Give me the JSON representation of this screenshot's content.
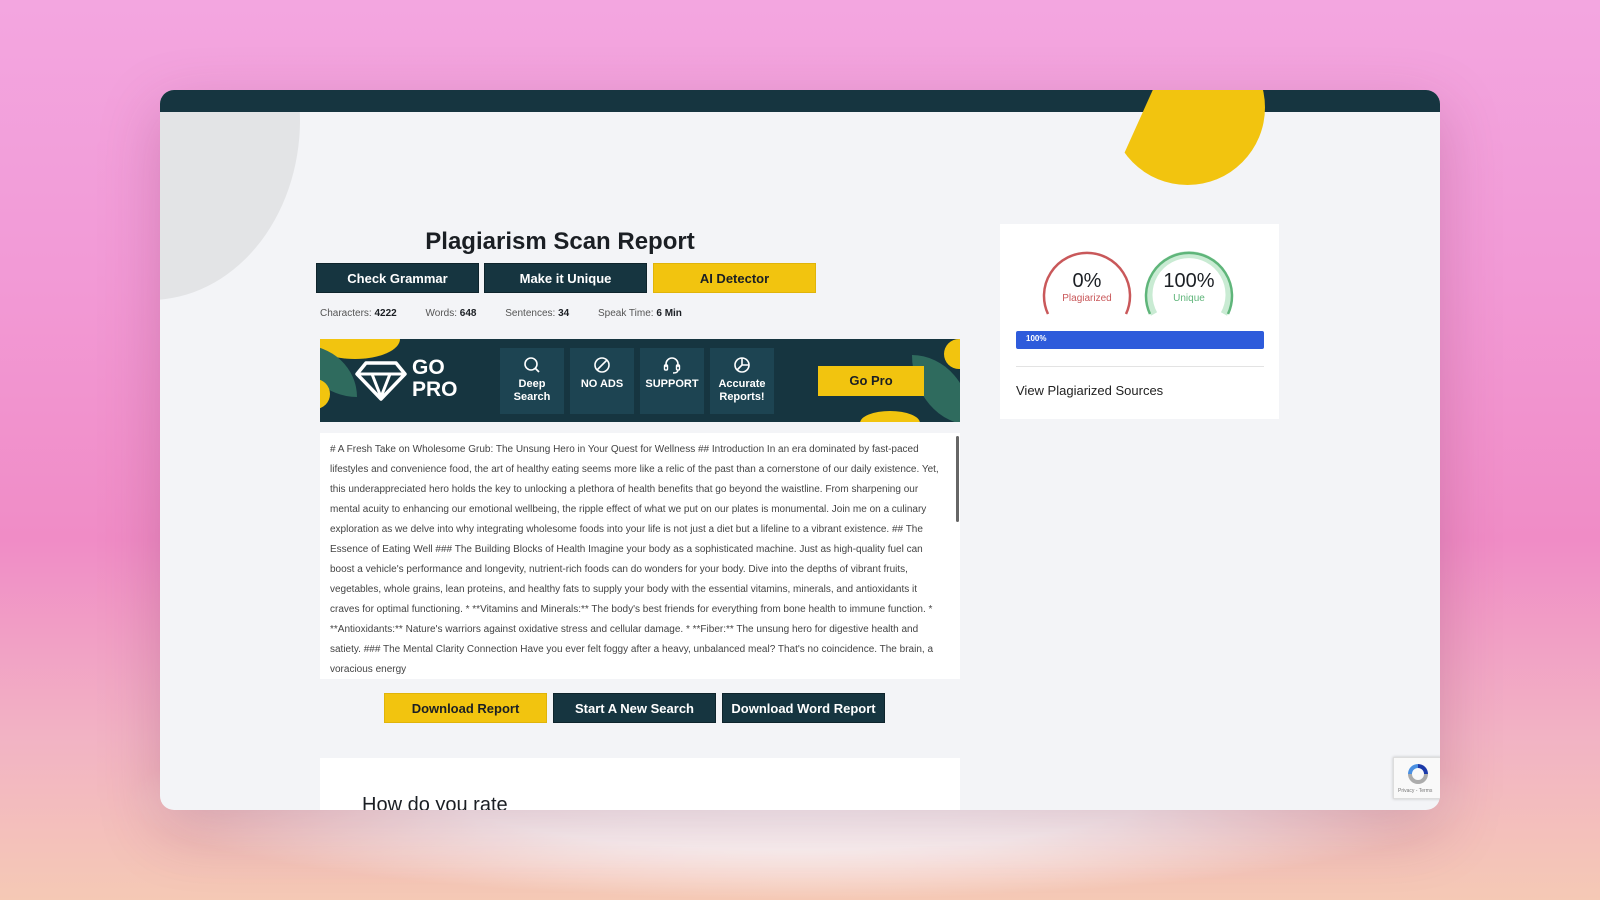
{
  "report": {
    "title": "Plagiarism Scan Report",
    "actions": {
      "check_grammar": "Check Grammar",
      "make_unique": "Make it Unique",
      "ai_detector": "AI Detector"
    },
    "stats": {
      "characters_label": "Characters:",
      "characters_value": "4222",
      "words_label": "Words:",
      "words_value": "648",
      "sentences_label": "Sentences:",
      "sentences_value": "34",
      "speak_time_label": "Speak Time:",
      "speak_time_value": "6 Min"
    }
  },
  "promo": {
    "headline_line1": "GO",
    "headline_line2": "PRO",
    "features": [
      {
        "icon": "search-icon",
        "line1": "Deep",
        "line2": "Search"
      },
      {
        "icon": "no-ads-icon",
        "line1": "NO ADS",
        "line2": ""
      },
      {
        "icon": "headset-icon",
        "line1": "SUPPORT",
        "line2": ""
      },
      {
        "icon": "pie-chart-icon",
        "line1": "Accurate",
        "line2": "Reports!"
      }
    ],
    "cta": "Go Pro",
    "colors": {
      "dark": "#163540",
      "accent": "#f2c40f"
    }
  },
  "content": {
    "text": "# A Fresh Take on Wholesome Grub: The Unsung Hero in Your Quest for Wellness ## Introduction In an era dominated by fast-paced lifestyles and convenience food, the art of healthy eating seems more like a relic of the past than a cornerstone of our daily existence. Yet, this underappreciated hero holds the key to unlocking a plethora of health benefits that go beyond the waistline. From sharpening our mental acuity to enhancing our emotional wellbeing, the ripple effect of what we put on our plates is monumental. Join me on a culinary exploration as we delve into why integrating wholesome foods into your life is not just a diet but a lifeline to a vibrant existence. ## The Essence of Eating Well ### The Building Blocks of Health Imagine your body as a sophisticated machine. Just as high-quality fuel can boost a vehicle's performance and longevity, nutrient-rich foods can do wonders for your body. Dive into the depths of vibrant fruits, vegetables, whole grains, lean proteins, and healthy fats to supply your body with the essential vitamins, minerals, and antioxidants it craves for optimal functioning. * **Vitamins and Minerals:** The body's best friends for everything from bone health to immune function. * **Antioxidants:** Nature's warriors against oxidative stress and cellular damage. * **Fiber:** The unsung hero for digestive health and satiety. ### The Mental Clarity Connection Have you ever felt foggy after a heavy, unbalanced meal? That's no coincidence. The brain, a voracious energy"
  },
  "bottom_actions": {
    "download_report": "Download Report",
    "new_search": "Start A New Search",
    "download_word": "Download Word Report"
  },
  "rating": {
    "title": "How do you rate"
  },
  "results": {
    "plagiarized_value": "0%",
    "plagiarized_label": "Plagiarized",
    "unique_value": "100%",
    "unique_label": "Unique",
    "unique_fraction": 1.0,
    "progress_label": "100%",
    "progress_fraction": 1.0,
    "sources_link": "View Plagiarized Sources",
    "colors": {
      "plagiarized": "#c9585a",
      "unique": "#5fb57a",
      "progress": "#2e5bdb"
    }
  },
  "recaptcha": {
    "label": "Privacy - Terms"
  }
}
